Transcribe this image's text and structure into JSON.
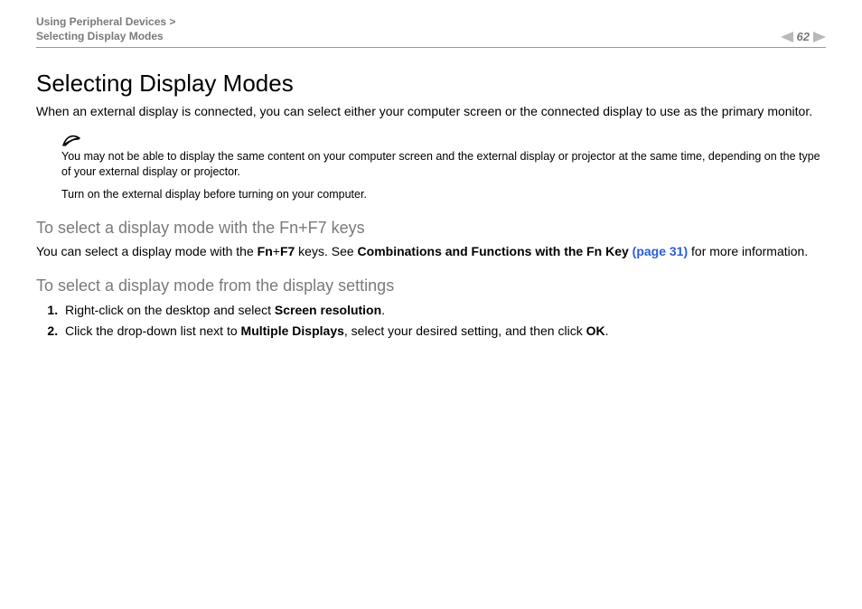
{
  "header": {
    "breadcrumb_parent": "Using Peripheral Devices >",
    "breadcrumb_current": "Selecting Display Modes",
    "page_number": "62"
  },
  "content": {
    "title": "Selecting Display Modes",
    "intro": "When an external display is connected, you can select either your computer screen or the connected display to use as the primary monitor.",
    "note1": "You may not be able to display the same content on your computer screen and the external display or projector at the same time, depending on the type of your external display or projector.",
    "note2": "Turn on the external display before turning on your computer.",
    "sub1": "To select a display mode with the Fn+F7 keys",
    "p_sub1_a": "You can select a display mode with the ",
    "p_sub1_fn": "Fn",
    "p_sub1_plus": "+",
    "p_sub1_f7": "F7",
    "p_sub1_b": " keys. See ",
    "p_sub1_ref": "Combinations and Functions with the Fn Key",
    "p_sub1_link": " (page 31)",
    "p_sub1_c": " for more information.",
    "sub2": "To select a display mode from the display settings",
    "step1_a": "Right-click on the desktop and select ",
    "step1_b": "Screen resolution",
    "step1_c": ".",
    "step2_a": "Click the drop-down list next to ",
    "step2_b": "Multiple Displays",
    "step2_c": ", select your desired setting, and then click ",
    "step2_d": "OK",
    "step2_e": "."
  }
}
